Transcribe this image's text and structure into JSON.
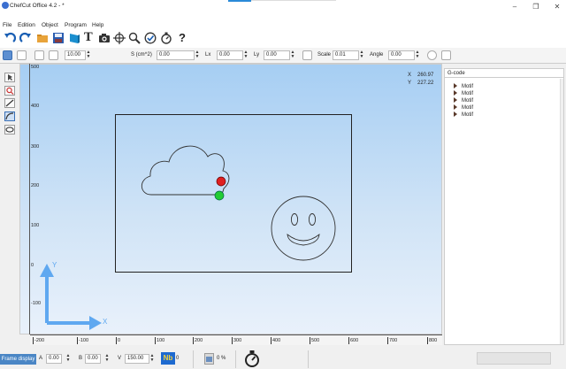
{
  "window": {
    "title": "ChefCut Office 4.2 - *",
    "accent_color": "#2a8ad8",
    "minimize_label": "–",
    "maximize_label": "❐",
    "close_label": "✕"
  },
  "menu": [
    "File",
    "Edition",
    "Object",
    "Program",
    "Help"
  ],
  "toolbar_icons": [
    "undo-icon",
    "redo-icon",
    "folder-open-icon",
    "save-icon",
    "export-icon",
    "text-icon",
    "camera-icon",
    "move-crosshair-icon",
    "zoom-icon",
    "check-icon",
    "stopwatch-icon",
    "help-icon"
  ],
  "help_label": "?",
  "text_tool_label": "T",
  "props": {
    "step_value": "10.00",
    "surface_label": "S (cm^2)",
    "surface_value": "0.00",
    "lx_label": "Lx",
    "lx_value": "0.00",
    "ly_label": "Ly",
    "ly_value": "0.00",
    "scale_label": "Scale",
    "scale_value": "0.01",
    "angle_label": "Angle",
    "angle_value": "0.00"
  },
  "coords": {
    "x_label": "X",
    "x_value": "260.97",
    "y_label": "Y",
    "y_value": "227.22"
  },
  "rulers": {
    "vertical": [
      "500",
      "400",
      "300",
      "200",
      "100",
      "0",
      "-100"
    ],
    "horizontal": [
      "-200",
      "-100",
      "0",
      "100",
      "200",
      "300",
      "400",
      "500",
      "600",
      "700",
      "800"
    ]
  },
  "axes": {
    "y_label": "Y",
    "x_label": "X"
  },
  "gcode": {
    "title": "G-code",
    "items": [
      "Motif",
      "Motif",
      "Motif",
      "Motif",
      "Motif"
    ]
  },
  "status": {
    "mode_label": "Frame display",
    "a_label": "A",
    "a_value": "0.00",
    "b_label": "B",
    "b_value": "0.00",
    "v_label": "V",
    "v_value": "150.00",
    "nb_badge": "Nb",
    "nb_value": "0",
    "percent_value": "0 %",
    "badge_color": "#1e6ad0"
  }
}
